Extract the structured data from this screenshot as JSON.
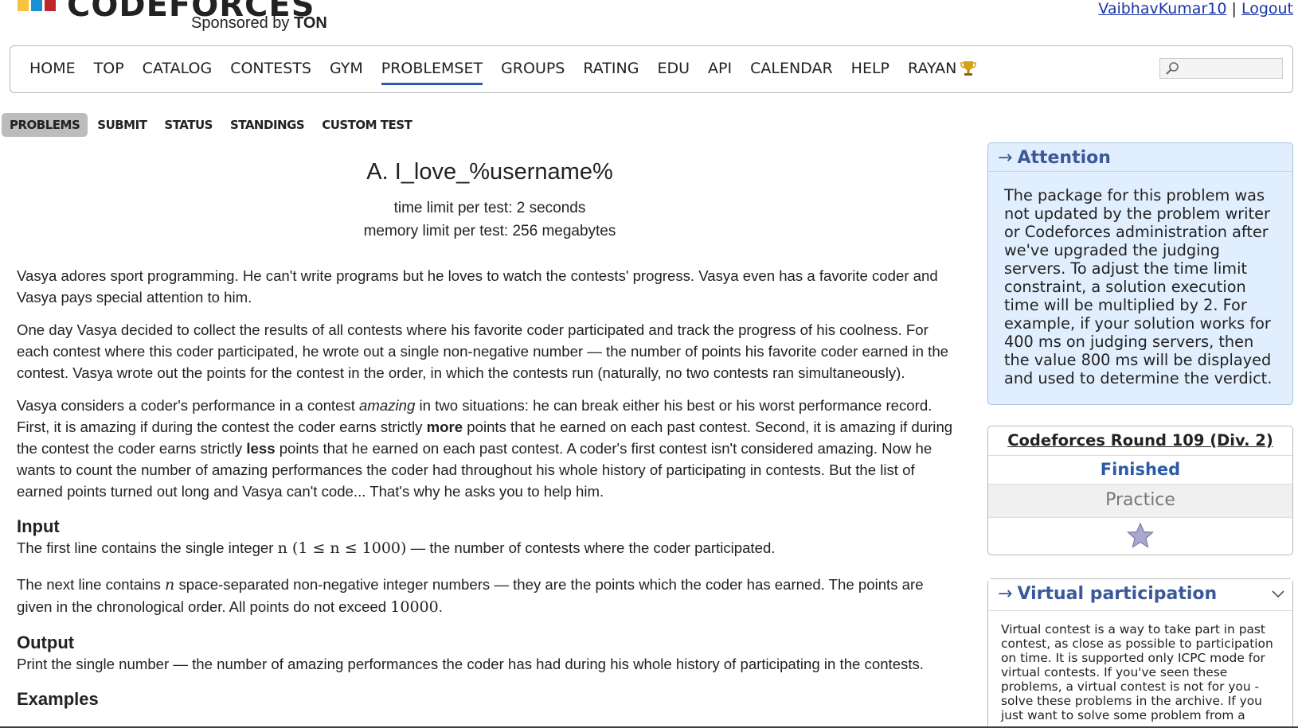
{
  "header": {
    "logo_text": "CODEFORCES",
    "logo_colors": [
      "#f6c43c",
      "#1a8fd6",
      "#c0272d"
    ],
    "sponsor_prefix": "Sponsored by ",
    "sponsor_name": "TON",
    "username": "VaibhavKumar10",
    "separator": "|",
    "logout": "Logout"
  },
  "nav": {
    "items": [
      {
        "label": "HOME"
      },
      {
        "label": "TOP"
      },
      {
        "label": "CATALOG"
      },
      {
        "label": "CONTESTS"
      },
      {
        "label": "GYM"
      },
      {
        "label": "PROBLEMSET"
      },
      {
        "label": "GROUPS"
      },
      {
        "label": "RATING"
      },
      {
        "label": "EDU"
      },
      {
        "label": "API"
      },
      {
        "label": "CALENDAR"
      },
      {
        "label": "HELP"
      },
      {
        "label": "RAYAN"
      }
    ],
    "active": "PROBLEMSET",
    "search_placeholder": ""
  },
  "subnav": {
    "items": [
      "PROBLEMS",
      "SUBMIT",
      "STATUS",
      "STANDINGS",
      "CUSTOM TEST"
    ],
    "active": "PROBLEMS"
  },
  "problem": {
    "title": "A. I_love_%username%",
    "time_limit": "time limit per test: 2 seconds",
    "memory_limit": "memory limit per test: 256 megabytes",
    "p1": "Vasya adores sport programming. He can't write programs but he loves to watch the contests' progress. Vasya even has a favorite coder and Vasya pays special attention to him.",
    "p2": "One day Vasya decided to collect the results of all contests where his favorite coder participated and track the progress of his coolness. For each contest where this coder participated, he wrote out a single non-negative number — the number of points his favorite coder earned in the contest. Vasya wrote out the points for the contest in the order, in which the contests run (naturally, no two contests ran simultaneously).",
    "p3_a": "Vasya considers a coder's performance in a contest ",
    "p3_amazing": "amazing",
    "p3_b": " in two situations: he can break either his best or his worst performance record. First, it is amazing if during the contest the coder earns strictly ",
    "p3_more": "more",
    "p3_c": " points that he earned on each past contest. Second, it is amazing if during the contest the coder earns strictly ",
    "p3_less": "less",
    "p3_d": " points that he earned on each past contest. A coder's first contest isn't considered amazing. Now he wants to count the number of amazing performances the coder had throughout his whole history of participating in contests. But the list of earned points turned out long and Vasya can't code... That's why he asks you to help him.",
    "input_title": "Input",
    "input_1a": "The first line contains the single integer ",
    "input_1_math": "n (1 ≤ n ≤ 1000)",
    "input_1b": " — the number of contests where the coder participated.",
    "input_2a": "The next line contains ",
    "input_2_n": "n",
    "input_2b": " space-separated non-negative integer numbers — they are the points which the coder has earned. The points are given in the chronological order. All points do not exceed ",
    "input_2_max": "10000",
    "input_2c": ".",
    "output_title": "Output",
    "output_text": "Print the single number — the number of amazing performances the coder has had during his whole history of participating in the contests.",
    "examples_title": "Examples"
  },
  "sidebar": {
    "arrow": "→",
    "attention_title": "Attention",
    "attention_text": "The package for this problem was not updated by the problem writer or Codeforces administration after we've upgraded the judging servers. To adjust the time limit constraint, a solution execution time will be multiplied by 2. For example, if your solution works for 400 ms on judging servers, then the value 800 ms will be displayed and used to determine the verdict.",
    "round_name": "Codeforces Round 109 (Div. 2)",
    "round_status": "Finished",
    "round_mode": "Practice",
    "virtual_title": "Virtual participation",
    "virtual_text": "Virtual contest is a way to take part in past contest, as close as possible to participation on time. It is supported only ICPC mode for virtual contests. If you've seen these problems, a virtual contest is not for you - solve these problems in the archive. If you just want to solve some problem from a"
  }
}
